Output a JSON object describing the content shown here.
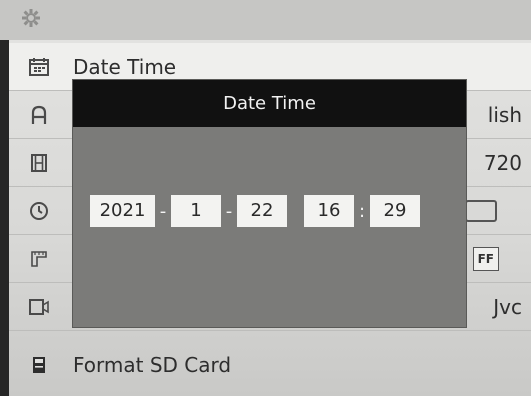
{
  "menu": {
    "items": [
      {
        "icon": "calendar-icon",
        "label": "Date Time",
        "value": ""
      },
      {
        "icon": "language-icon",
        "label": "",
        "value": "lish"
      },
      {
        "icon": "film-icon",
        "label": "",
        "value": "720"
      },
      {
        "icon": "clock-icon",
        "label": "",
        "value": ""
      },
      {
        "icon": "ruler-icon",
        "label": "",
        "value": "FF"
      },
      {
        "icon": "video-camera-icon",
        "label": "",
        "value": "Jvc"
      },
      {
        "icon": "sd-card-icon",
        "label": "Format SD Card",
        "value": ""
      }
    ]
  },
  "dialog": {
    "title": "Date Time",
    "year": "2021",
    "month": "1",
    "day": "22",
    "hour": "16",
    "minute": "29",
    "date_separator": "-",
    "time_separator": ":"
  },
  "colors": {
    "dialog_title_bg": "#111111",
    "dialog_body_bg": "#7b7b79",
    "field_bg": "#f3f3f1",
    "screen_bg": "#dcdcda"
  }
}
